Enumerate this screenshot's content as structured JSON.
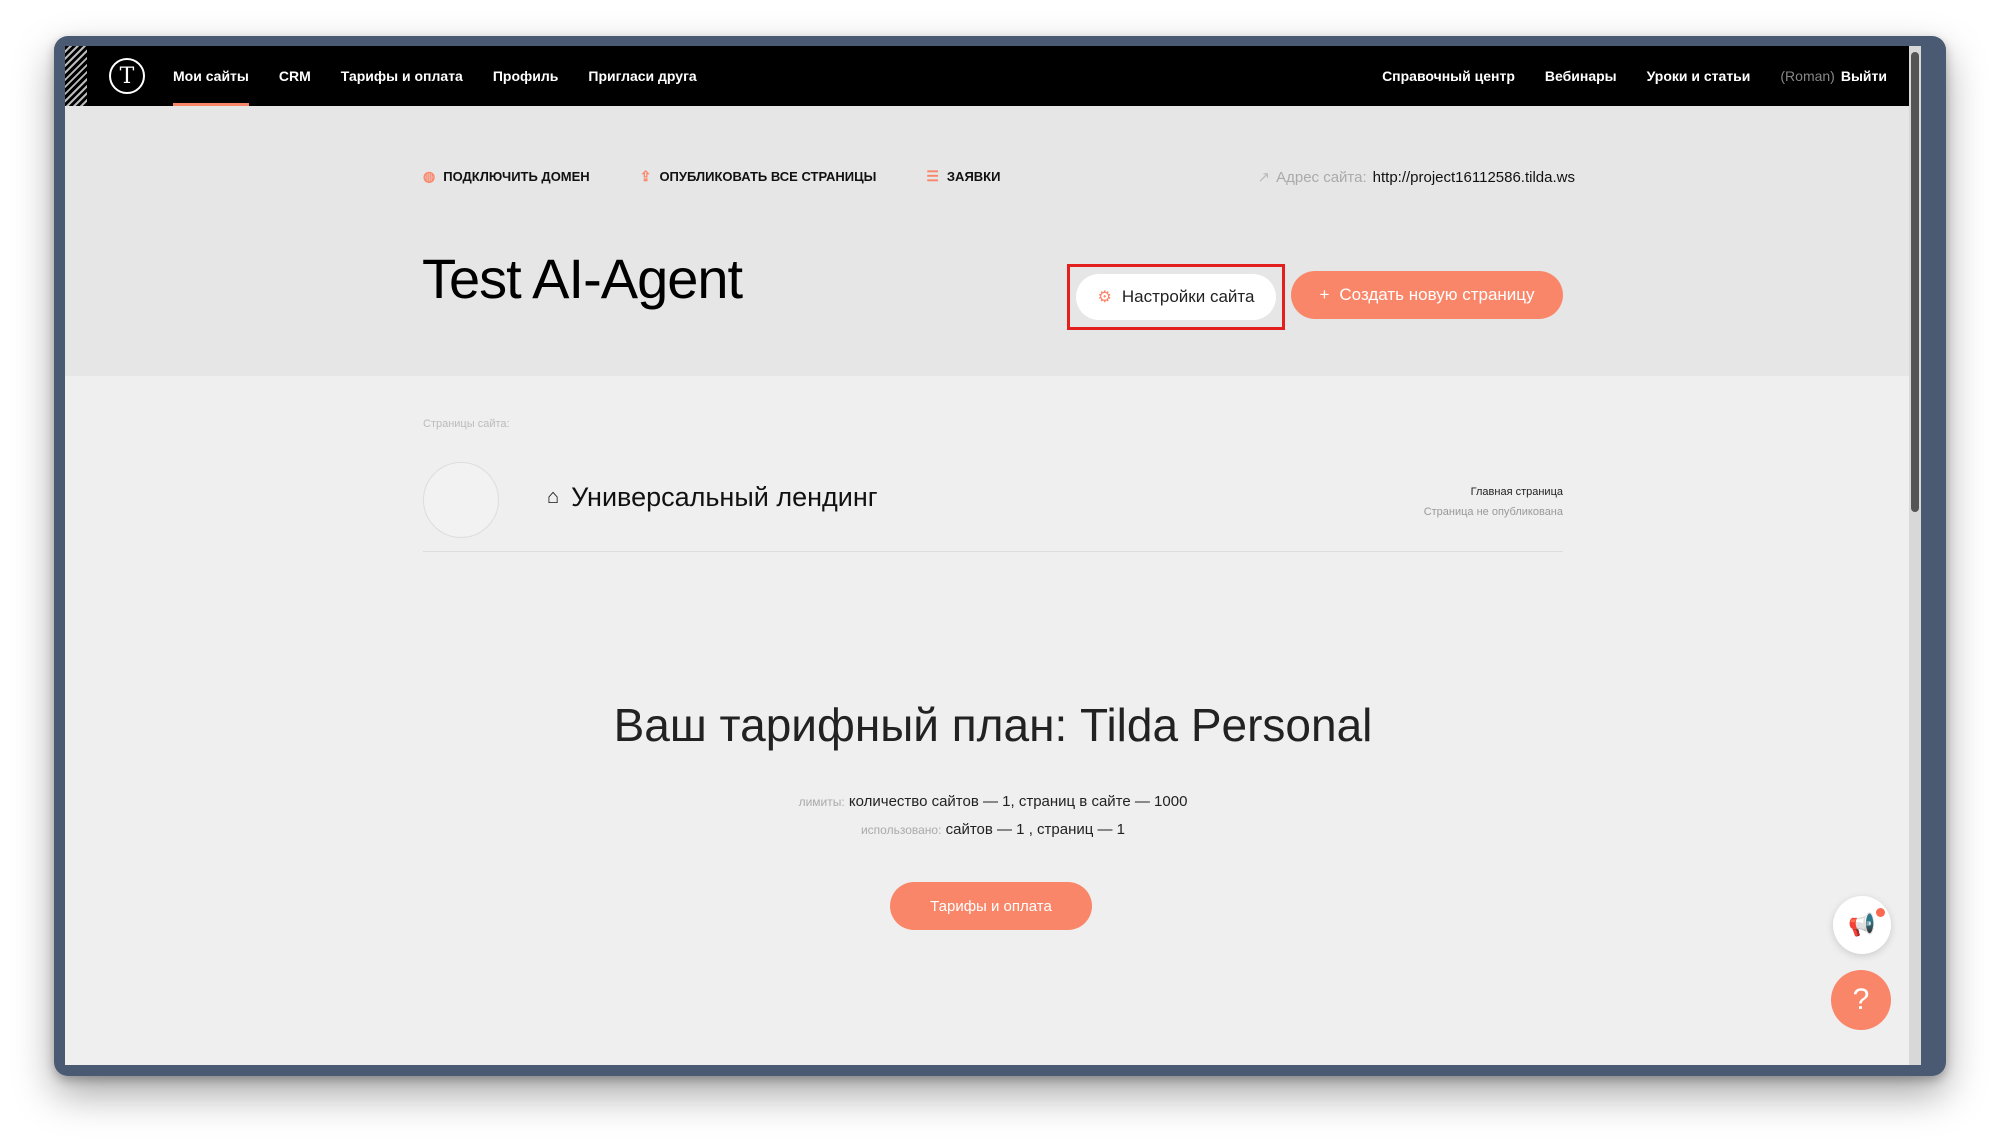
{
  "nav": {
    "logo_glyph": "T",
    "left_items": [
      "Мои сайты",
      "CRM",
      "Тарифы и оплата",
      "Профиль",
      "Пригласи друга"
    ],
    "active_item": "Мои сайты",
    "right_items": [
      "Справочный центр",
      "Вебинары",
      "Уроки и статьи"
    ],
    "user_name": "(Roman)",
    "logout": "Выйти"
  },
  "actions": {
    "connect_domain": "ПОДКЛЮЧИТЬ ДОМЕН",
    "publish_all": "ОПУБЛИКОВАТЬ ВСЕ СТРАНИЦЫ",
    "requests": "ЗАЯВКИ",
    "site_address_label": "Адрес сайта:",
    "site_address": "http://project16112586.tilda.ws"
  },
  "site": {
    "title": "Test AI-Agent",
    "settings_button": "Настройки сайта",
    "create_page_button": "Создать новую страницу"
  },
  "pages": {
    "section_label": "Страницы сайта:",
    "items": [
      {
        "title": "Универсальный лендинг",
        "meta_main": "Главная страница",
        "meta_status": "Страница не опубликована"
      }
    ]
  },
  "plan": {
    "title": "Ваш тарифный план: Tilda Personal",
    "limits_label": "лимиты:",
    "limits_value": "количество сайтов — 1, страниц в сайте — 1000",
    "used_label": "использовано:",
    "used_value": "сайтов — 1 , страниц — 1",
    "button": "Тарифы и оплата"
  },
  "widgets": {
    "help_glyph": "?"
  },
  "colors": {
    "accent": "#fa8669",
    "highlight_box": "#e3201d",
    "nav_bg": "#000000"
  }
}
